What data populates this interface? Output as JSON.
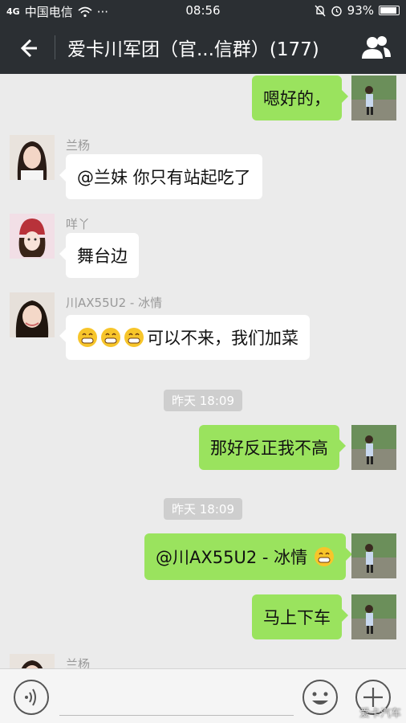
{
  "status_bar": {
    "signal_text": "4G",
    "carrier": "中国电信",
    "dots": "···",
    "time": "08:56",
    "battery": "93%",
    "battery_level": 0.93
  },
  "header": {
    "title": "爱卡川军团（官...信群）(177)",
    "back_icon": "back-arrow-icon",
    "members_icon": "group-members-icon"
  },
  "messages": [
    {
      "type": "out",
      "text": "嗯好的，",
      "avatar": "self-avatar"
    },
    {
      "type": "in",
      "sender": "兰杨",
      "text": "@兰妹 你只有站起吃了",
      "avatar": "lanyang-avatar"
    },
    {
      "type": "in",
      "sender": "咩丫",
      "text": "舞台边",
      "avatar": "mieya-avatar"
    },
    {
      "type": "in",
      "sender": "川AX55U2 - 冰情",
      "emoji_count": 3,
      "text": "可以不来，我们加菜",
      "avatar": "bingqing-avatar"
    },
    {
      "type": "time",
      "text": "昨天 18:09"
    },
    {
      "type": "out",
      "text": "那好反正我不高",
      "avatar": "self-avatar"
    },
    {
      "type": "time",
      "text": "昨天 18:09"
    },
    {
      "type": "out",
      "text": "@川AX55U2 - 冰情",
      "emoji_count": 1,
      "avatar": "self-avatar"
    },
    {
      "type": "out",
      "text": "马上下车",
      "avatar": "self-avatar"
    },
    {
      "type": "in",
      "sender": "兰杨",
      "text": "",
      "avatar": "lanyang-avatar"
    }
  ],
  "input_bar": {
    "voice_icon": "voice-icon",
    "emoji_icon": "smiley-icon",
    "more_icon": "plus-icon",
    "placeholder": ""
  },
  "watermark": "爱卡汽车"
}
